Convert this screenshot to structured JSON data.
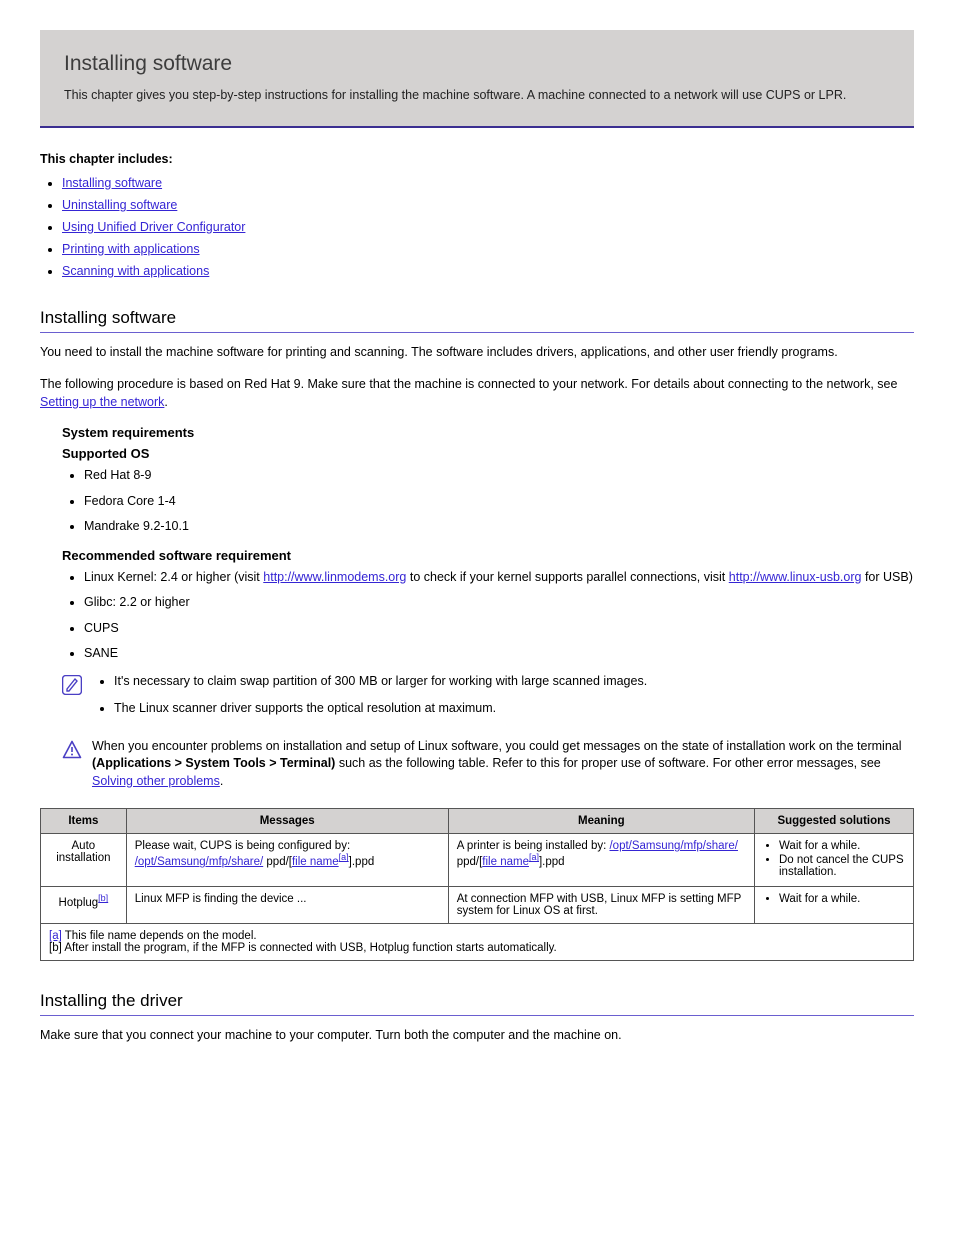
{
  "chapter": {
    "title": "Installing software",
    "intro": "This chapter gives you step-by-step instructions for installing the machine software. A machine connected to a network will use CUPS or LPR."
  },
  "toc": {
    "label": "This chapter includes:",
    "items": [
      "Installing software",
      "Uninstalling software",
      "Using Unified Driver Configurator",
      "Printing with applications",
      "Scanning with applications"
    ]
  },
  "sections": {
    "install": {
      "heading": "Installing software",
      "para1": "You need to install the machine software for printing and scanning. The software includes drivers, applications, and other user friendly programs.",
      "para2_a": "The following procedure is based on Red Hat 9. Make sure that the machine is connected to your network. For details about connecting to the network, see ",
      "para2_link": "Setting up the network",
      "para2_b": ".",
      "reqs_heading": "System requirements",
      "os_label": "Supported OS",
      "os_items": [
        "Red Hat 8-9",
        "Fedora Core 1-4",
        "Mandrake 9.2-10.1"
      ],
      "sw_label": "Recommended software requirement",
      "sw_items": [
        {
          "prefix": "Linux Kernel: 2.4 or higher (visit ",
          "link": "http://www.linmodems.org",
          "suffix_a": " to check if your kernel supports parallel connections, visit ",
          "link2": "http://www.linux-usb.org",
          "suffix_b": " for USB)"
        },
        {
          "text": "Glibc: 2.2 or higher"
        },
        {
          "text": "CUPS"
        },
        {
          "text": "SANE"
        }
      ],
      "note_items": [
        "It's necessary to claim swap partition of 300 MB or larger for working with large scanned images.",
        "The Linux scanner driver supports the optical resolution at maximum."
      ],
      "caution_text_a": "When you encounter problems on installation and setup of Linux software, you could get messages on the state of installation work on the terminal ",
      "caution_bold": "(Applications > System Tools > Terminal)",
      "caution_text_b": " such as the following table. Refer to this for proper use of software. For other error messages, see ",
      "caution_link": "Solving other problems",
      "caution_text_c": ".",
      "table": {
        "headers": [
          "Items",
          "Messages",
          "Meaning",
          "Suggested solutions"
        ],
        "rows": [
          {
            "item": "Auto installation",
            "msg_a": "Please wait, CUPS is being configured by: ",
            "msg_link": "/opt/Samsung/mfp/share/",
            "msg_b": " ppd/",
            "msg_c_prefix": "[",
            "msg_c_link": "file name",
            "msg_c_suffix": "[a]",
            "msg_d": "].ppd",
            "mean_a": "A printer is being installed by: ",
            "mean_link": "/opt/Samsung/mfp/share/",
            "mean_b": " ppd/",
            "mean_c_prefix": "[",
            "mean_c_link": "file name",
            "mean_c_suffix": "[a]",
            "mean_d": "].ppd",
            "sol": [
              "Wait for a while.",
              "Do not cancel the CUPS installation."
            ]
          },
          {
            "item_a": "Hotplug",
            "item_link": "[b]",
            "msg": "Linux MFP is finding the device ...",
            "mean": "At connection MFP with USB, Linux MFP is setting MFP system for Linux OS at first.",
            "sol": [
              "Wait for a while."
            ]
          }
        ],
        "footnote_a": "[a]",
        "footnote_a_text": " This file name depends on the model.",
        "footnote_b": "[b] After install the program, if the MFP is connected with USB, Hotplug function starts automatically."
      }
    },
    "driver": {
      "heading": "Installing the driver",
      "para": "Make sure that you connect your machine to your computer. Turn both the computer and the machine on."
    }
  }
}
